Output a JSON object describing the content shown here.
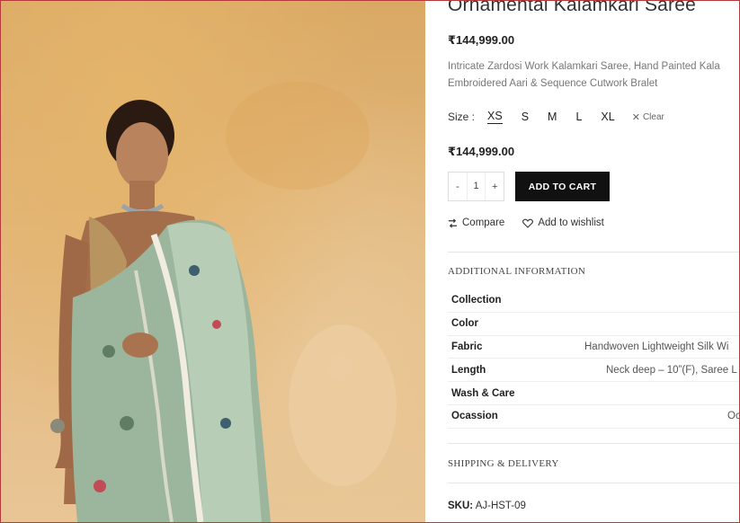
{
  "product": {
    "title": "Ornamental Kalamkari Saree",
    "price": "₹144,999.00",
    "description_line1": "Intricate Zardosi Work Kalamkari Saree, Hand Painted Kala",
    "description_line2": "Embroidered Aari & Sequence Cutwork Bralet",
    "variation_price": "₹144,999.00",
    "sku_label": "SKU:",
    "sku_value": "AJ-HST-09"
  },
  "size": {
    "label": "Size :",
    "options": [
      "XS",
      "S",
      "M",
      "L",
      "XL"
    ],
    "selected": "XS",
    "clear_label": "Clear"
  },
  "cart": {
    "minus_label": "-",
    "quantity": "1",
    "plus_label": "+",
    "add_to_cart_label": "ADD TO CART"
  },
  "actions": {
    "compare_label": "Compare",
    "wishlist_label": "Add to wishlist"
  },
  "additional_info": {
    "title": "ADDITIONAL INFORMATION",
    "rows": [
      {
        "key": "Collection",
        "value": ""
      },
      {
        "key": "Color",
        "value": ""
      },
      {
        "key": "Fabric",
        "value": "Handwoven Lightweight Silk Wi"
      },
      {
        "key": "Length",
        "value": "Neck deep – 10”(F), Saree L"
      },
      {
        "key": "Wash & Care",
        "value": ""
      },
      {
        "key": "Ocassion",
        "value": "Oc"
      }
    ]
  },
  "shipping": {
    "title": "SHIPPING & DELIVERY"
  },
  "colors": {
    "button_bg": "#111111",
    "frame_border": "#b33a3a"
  }
}
